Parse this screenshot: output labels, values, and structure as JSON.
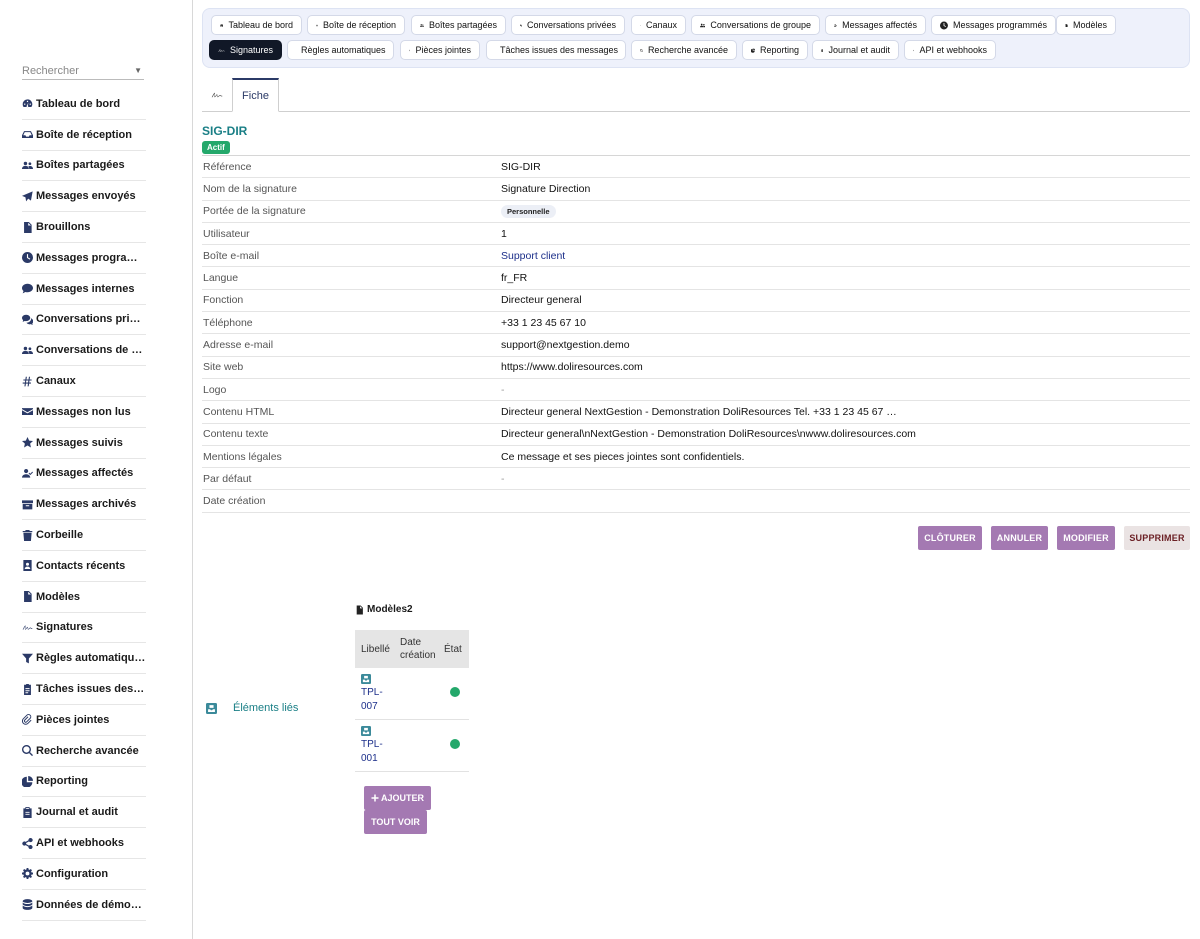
{
  "sidebar": {
    "search_placeholder": "Rechercher",
    "items": [
      {
        "label": "Tableau de bord",
        "icon": "dashboard-icon"
      },
      {
        "label": "Boîte de réception",
        "icon": "inbox-icon"
      },
      {
        "label": "Boîtes partagées",
        "icon": "users-icon"
      },
      {
        "label": "Messages envoyés",
        "icon": "paper-plane-icon"
      },
      {
        "label": "Brouillons",
        "icon": "file-icon"
      },
      {
        "label": "Messages programmés",
        "icon": "clock-icon"
      },
      {
        "label": "Messages internes",
        "icon": "comment-icon"
      },
      {
        "label": "Conversations privées",
        "icon": "comments-icon"
      },
      {
        "label": "Conversations de groupe",
        "icon": "users-icon"
      },
      {
        "label": "Canaux",
        "icon": "hashtag-icon"
      },
      {
        "label": "Messages non lus",
        "icon": "envelope-icon"
      },
      {
        "label": "Messages suivis",
        "icon": "star-icon"
      },
      {
        "label": "Messages affectés",
        "icon": "user-check-icon"
      },
      {
        "label": "Messages archivés",
        "icon": "archive-icon"
      },
      {
        "label": "Corbeille",
        "icon": "trash-icon"
      },
      {
        "label": "Contacts récents",
        "icon": "contact-icon"
      },
      {
        "label": "Modèles",
        "icon": "file-icon"
      },
      {
        "label": "Signatures",
        "icon": "signature-icon"
      },
      {
        "label": "Règles automatiques",
        "icon": "filter-icon"
      },
      {
        "label": "Tâches issues des messages",
        "icon": "tasks-icon"
      },
      {
        "label": "Pièces jointes",
        "icon": "paperclip-icon"
      },
      {
        "label": "Recherche avancée",
        "icon": "search-icon"
      },
      {
        "label": "Reporting",
        "icon": "chart-pie-icon"
      },
      {
        "label": "Journal et audit",
        "icon": "clipboard-icon"
      },
      {
        "label": "API et webhooks",
        "icon": "share-icon"
      },
      {
        "label": "Configuration",
        "icon": "gear-icon"
      },
      {
        "label": "Données de démonstration",
        "icon": "database-icon"
      }
    ]
  },
  "tabs": [
    {
      "label": "Tableau de bord",
      "icon": "dashboard-icon"
    },
    {
      "label": "Boîte de réception",
      "icon": "inbox-icon"
    },
    {
      "label": "Boîtes partagées",
      "icon": "users-icon"
    },
    {
      "label": "Conversations privées",
      "icon": "comments-icon"
    },
    {
      "label": "Canaux",
      "icon": "hashtag-icon"
    },
    {
      "label": "Conversations de groupe",
      "icon": "users-icon"
    },
    {
      "label": "Messages affectés",
      "icon": "user-check-icon"
    },
    {
      "label": "Messages programmés",
      "icon": "clock-icon"
    },
    {
      "label": "Modèles",
      "icon": "file-icon"
    },
    {
      "label": "Signatures",
      "icon": "signature-icon",
      "active": true
    },
    {
      "label": "Règles automatiques",
      "icon": "filter-icon"
    },
    {
      "label": "Pièces jointes",
      "icon": "paperclip-icon"
    },
    {
      "label": "Tâches issues des messages",
      "icon": "tasks-icon"
    },
    {
      "label": "Recherche avancée",
      "icon": "search-icon"
    },
    {
      "label": "Reporting",
      "icon": "chart-pie-icon"
    },
    {
      "label": "Journal et audit",
      "icon": "clipboard-icon"
    },
    {
      "label": "API et webhooks",
      "icon": "share-icon"
    }
  ],
  "subtabs": {
    "fiche": "Fiche"
  },
  "record": {
    "ref": "SIG-DIR",
    "status": "Actif",
    "fields": [
      {
        "key": "Référence",
        "value": "SIG-DIR"
      },
      {
        "key": "Nom de la signature",
        "value": "Signature Direction"
      },
      {
        "key": "Portée de la signature",
        "value": "Personnelle",
        "type": "pill"
      },
      {
        "key": "Utilisateur",
        "value": "1"
      },
      {
        "key": "Boîte e-mail",
        "value": "Support client",
        "type": "link"
      },
      {
        "key": "Langue",
        "value": "fr_FR"
      },
      {
        "key": "Fonction",
        "value": "Directeur general"
      },
      {
        "key": "Téléphone",
        "value": "+33 1 23 45 67 10"
      },
      {
        "key": "Adresse e-mail",
        "value": "support@nextgestion.demo"
      },
      {
        "key": "Site web",
        "value": "https://www.doliresources.com"
      },
      {
        "key": "Logo",
        "value": "-",
        "type": "muted"
      },
      {
        "key": "Contenu HTML",
        "value": "Directeur general NextGestion - Demonstration DoliResources Tel. +33 1 23 45 67 …"
      },
      {
        "key": "Contenu texte",
        "value": "Directeur general\\nNextGestion - Demonstration DoliResources\\nwww.doliresources.com"
      },
      {
        "key": "Mentions légales",
        "value": "Ce message et ses pieces jointes sont confidentiels."
      },
      {
        "key": "Par défaut",
        "value": "-",
        "type": "muted"
      },
      {
        "key": "Date création",
        "value": ""
      }
    ]
  },
  "actions": {
    "close": "CLÔTURER",
    "cancel": "ANNULER",
    "edit": "MODIFIER",
    "delete": "SUPPRIMER"
  },
  "linked": {
    "label": "Éléments liés",
    "models_title": "Modèles",
    "models_count": "2",
    "columns": [
      "Libellé",
      "Date création",
      "État"
    ],
    "rows": [
      {
        "label": "TPL-007",
        "status": "active"
      },
      {
        "label": "TPL-001",
        "status": "active"
      }
    ],
    "add": "AJOUTER",
    "view_all": "TOUT VOIR"
  },
  "colors": {
    "accent": "#2b3a67",
    "teal": "#1a7f86",
    "success": "#24a86b",
    "button": "#a479b2"
  }
}
